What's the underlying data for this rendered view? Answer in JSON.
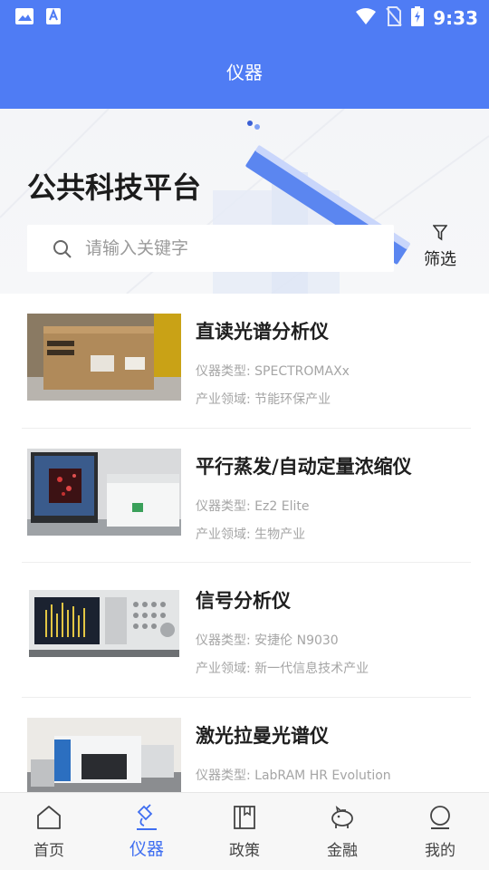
{
  "status_bar": {
    "time": "9:33"
  },
  "header": {
    "title": "仪器"
  },
  "banner": {
    "headline": "公共科技平台"
  },
  "search": {
    "placeholder": "请输入关键字"
  },
  "filter": {
    "label": "筛选"
  },
  "items": [
    {
      "name": "直读光谱分析仪",
      "type": "仪器类型: SPECTROMAXx",
      "field": "产业领域: 节能环保产业"
    },
    {
      "name": "平行蒸发/自动定量浓缩仪",
      "type": "仪器类型: Ez2 Elite",
      "field": "产业领域: 生物产业"
    },
    {
      "name": "信号分析仪",
      "type": "仪器类型: 安捷伦 N9030",
      "field": "产业领域: 新一代信息技术产业"
    },
    {
      "name": "激光拉曼光谱仪",
      "type": "仪器类型: LabRAM HR Evolution",
      "field": ""
    }
  ],
  "tabs": [
    {
      "label": "首页",
      "icon": "home-icon"
    },
    {
      "label": "仪器",
      "icon": "instrument-icon"
    },
    {
      "label": "政策",
      "icon": "book-icon"
    },
    {
      "label": "金融",
      "icon": "piggy-bank-icon"
    },
    {
      "label": "我的",
      "icon": "profile-icon"
    }
  ],
  "colors": {
    "primary": "#4f7cf4",
    "active_tab": "#3f6ef1"
  }
}
